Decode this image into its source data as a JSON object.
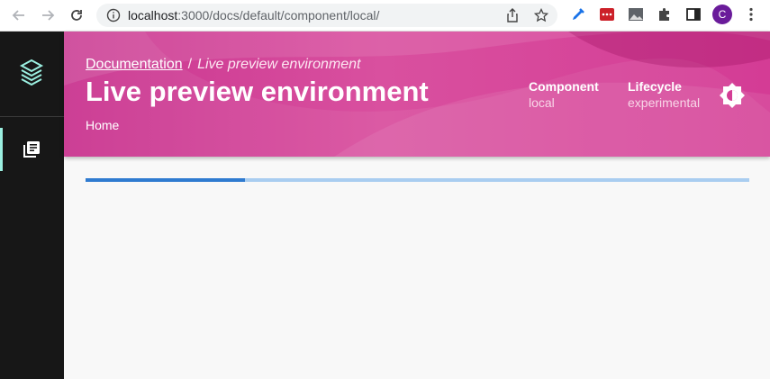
{
  "browser": {
    "url_host": "localhost",
    "url_path": ":3000/docs/default/component/local/",
    "profile_initial": "C",
    "icons": [
      "back-arrow-icon",
      "forward-arrow-icon",
      "reload-icon",
      "site-info-icon",
      "share-icon",
      "bookmark-star-icon",
      "extension-pen-icon",
      "extension-lastpass-icon",
      "extension-image-icon",
      "extensions-puzzle-icon",
      "side-panel-icon",
      "menu-dots-icon"
    ]
  },
  "sidebar": {
    "logo_icon": "backstage-logo-icon",
    "items": [
      {
        "icon": "docs-library-icon",
        "active": true
      }
    ]
  },
  "header": {
    "breadcrumb_link": "Documentation",
    "breadcrumb_sep": "/",
    "breadcrumb_current": "Live preview environment",
    "title": "Live preview environment",
    "subtitle": "Home",
    "meta": [
      {
        "label": "Component",
        "value": "local"
      },
      {
        "label": "Lifecycle",
        "value": "experimental"
      }
    ],
    "theme_toggle_icon": "brightness-icon"
  },
  "progress": {
    "value": 0.24
  },
  "colors": {
    "header_accent": "#d43c95",
    "sidebar_bg": "#171717",
    "active_indicator": "#9bf0e1",
    "progress_fill": "#2f7bd0",
    "progress_track": "#a9cdf0"
  }
}
